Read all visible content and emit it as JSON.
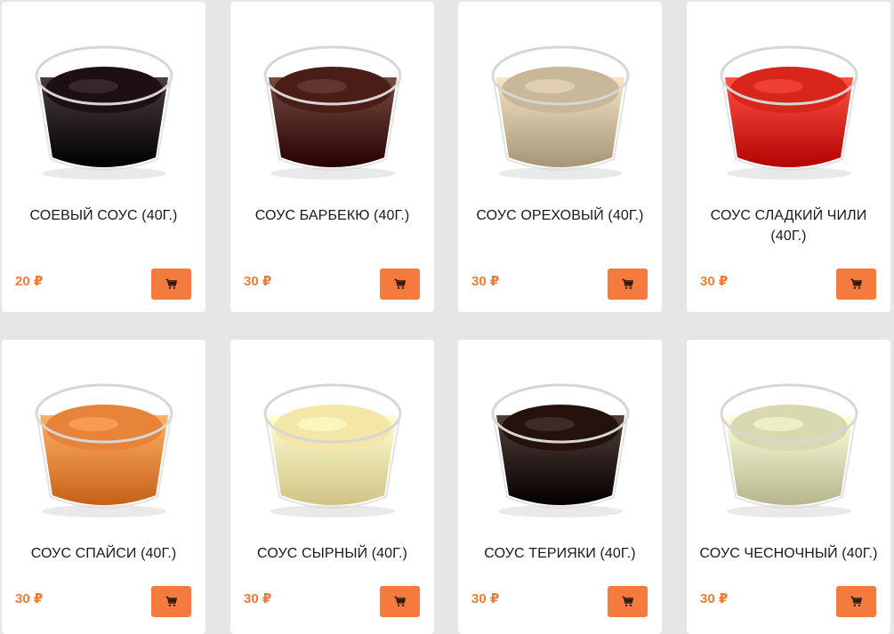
{
  "colors": {
    "background": "#e6e6e6",
    "card": "#ffffff",
    "price": "#f37a33",
    "button": "#f47a3d"
  },
  "products": [
    {
      "title": "СОЕВЫЙ СОУС (40Г.)",
      "price": "20 ₽",
      "image": "soy-sauce-cup-image",
      "sauce_color": "#1d0f12",
      "cart_icon": "cart-icon"
    },
    {
      "title": "СОУС БАРБЕКЮ (40Г.)",
      "price": "30 ₽",
      "image": "barbecue-sauce-cup-image",
      "sauce_color": "#4a1e16",
      "cart_icon": "cart-icon"
    },
    {
      "title": "СОУС ОРЕХОВЫЙ (40Г.)",
      "price": "30 ₽",
      "image": "nut-sauce-cup-image",
      "sauce_color": "#c9b79a",
      "cart_icon": "cart-icon"
    },
    {
      "title": "СОУС СЛАДКИЙ ЧИЛИ (40Г.)",
      "price": "30 ₽",
      "image": "sweet-chili-sauce-cup-image",
      "sauce_color": "#d8261b",
      "cart_icon": "cart-icon"
    },
    {
      "title": "СОУС СПАЙСИ (40Г.)",
      "price": "30 ₽",
      "image": "spicy-sauce-cup-image",
      "sauce_color": "#e8843a",
      "cart_icon": "cart-icon"
    },
    {
      "title": "СОУС СЫРНЫЙ (40Г.)",
      "price": "30 ₽",
      "image": "cheese-sauce-cup-image",
      "sauce_color": "#f3e6a6",
      "cart_icon": "cart-icon"
    },
    {
      "title": "СОУС ТЕРИЯКИ (40Г.)",
      "price": "30 ₽",
      "image": "teriyaki-sauce-cup-image",
      "sauce_color": "#26120d",
      "cart_icon": "cart-icon"
    },
    {
      "title": "СОУС ЧЕСНОЧНЫЙ (40Г.)",
      "price": "30 ₽",
      "image": "garlic-sauce-cup-image",
      "sauce_color": "#d8d9b0",
      "cart_icon": "cart-icon"
    }
  ]
}
